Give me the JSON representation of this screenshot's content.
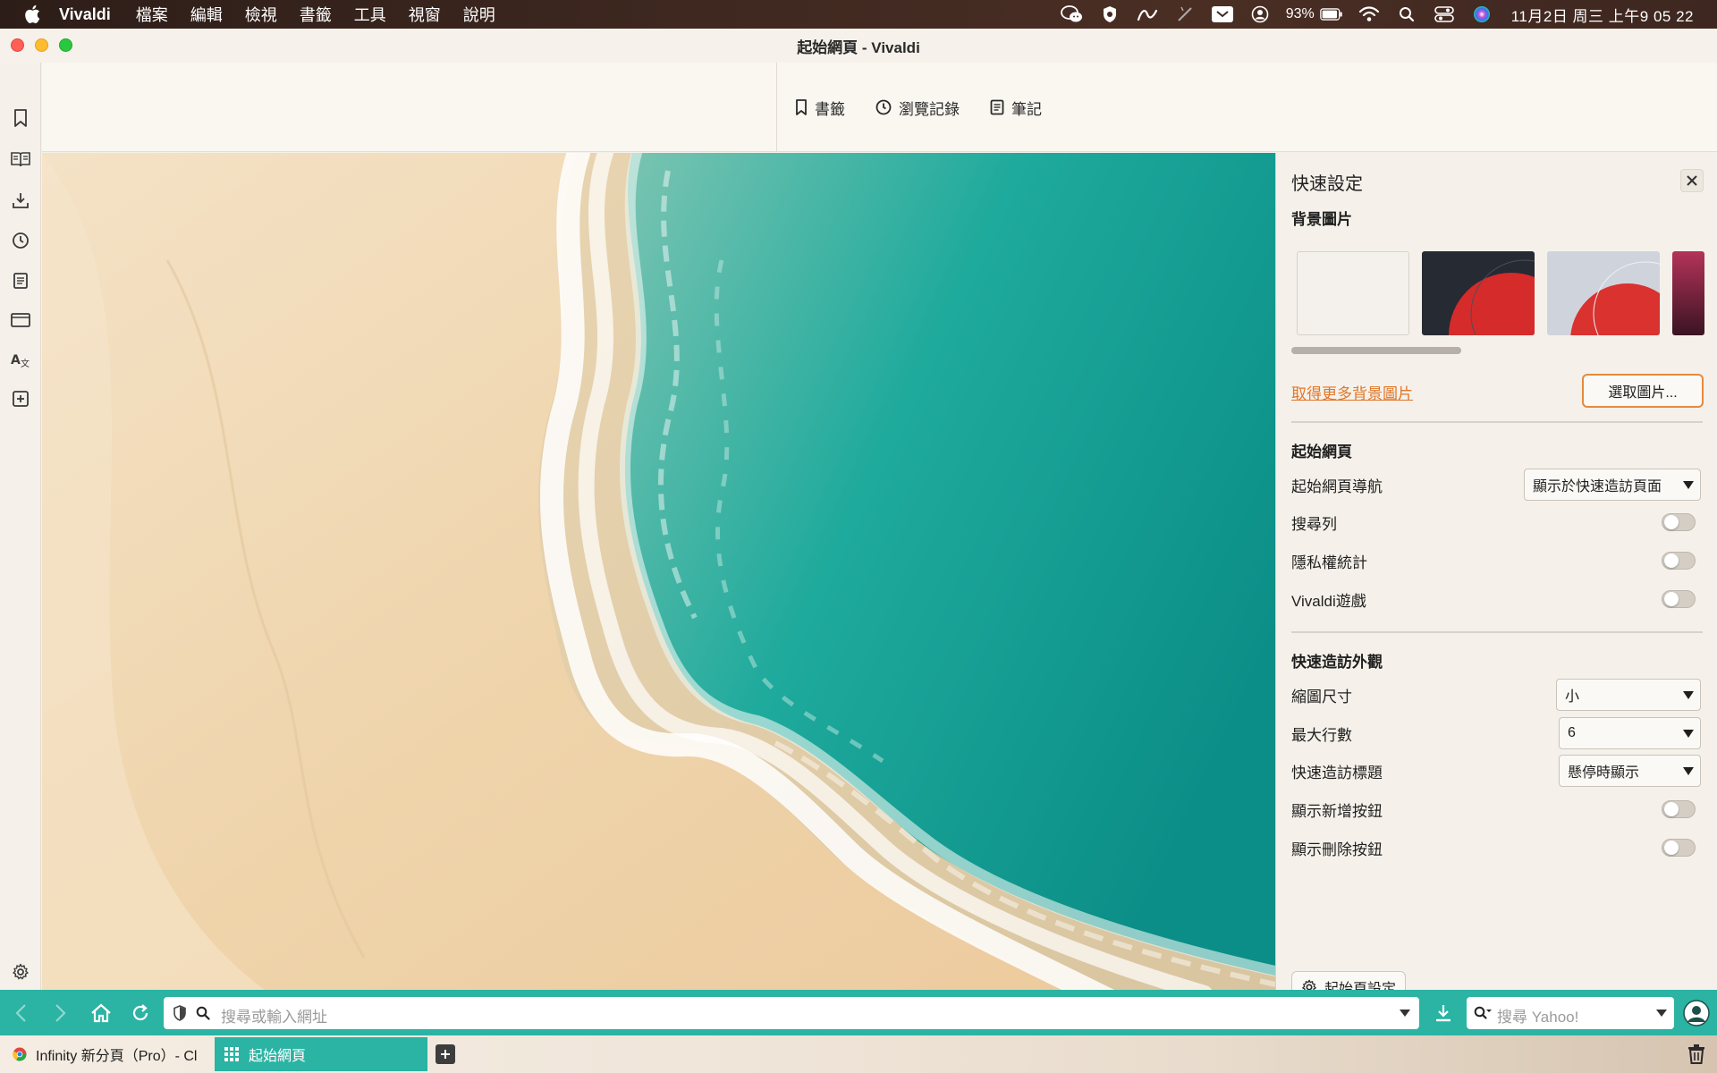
{
  "menubar": {
    "app_name": "Vivaldi",
    "menus": [
      "檔案",
      "編輯",
      "檢視",
      "書籤",
      "工具",
      "視窗",
      "說明"
    ],
    "battery": "93%",
    "clock": "11月2日 周三  上午9 05 22"
  },
  "window": {
    "title": "起始網頁 - Vivaldi"
  },
  "panel_tabs": [
    {
      "label": "書籤",
      "icon": "bookmark-icon"
    },
    {
      "label": "瀏覽記錄",
      "icon": "history-icon"
    },
    {
      "label": "筆記",
      "icon": "notes-icon"
    }
  ],
  "sidebar_icons": [
    "bookmarks-icon",
    "reading-list-icon",
    "downloads-icon",
    "history-icon",
    "notes-icon",
    "window-panel-icon",
    "translate-icon",
    "add-web-panel-icon",
    "settings-icon"
  ],
  "quick_settings": {
    "title": "快速設定",
    "background_section": "背景圖片",
    "more_backgrounds_link": "取得更多背景圖片",
    "pick_image_button": "選取圖片...",
    "start_page_section": "起始網頁",
    "start_nav_label": "起始網頁導航",
    "start_nav_value": "顯示於快速造訪頁面",
    "search_bar_label": "搜尋列",
    "privacy_stats_label": "隱私權統計",
    "vivaldi_game_label": "Vivaldi遊戲",
    "appearance_section": "快速造訪外觀",
    "thumb_size_label": "縮圖尺寸",
    "thumb_size_value": "小",
    "max_columns_label": "最大行數",
    "max_columns_value": "6",
    "speed_dial_title_label": "快速造訪標題",
    "speed_dial_title_value": "懸停時顯示",
    "show_add_label": "顯示新增按鈕",
    "show_delete_label": "顯示刪除按鈕",
    "start_settings_button": "起始頁設定",
    "toggles": {
      "search_bar": false,
      "privacy_stats": false,
      "vivaldi_game": false,
      "show_add": false,
      "show_delete": false
    }
  },
  "addressbar": {
    "url_placeholder": "搜尋或輸入網址",
    "search_placeholder": "搜尋 Yahoo!",
    "accent": "#2bb3a3"
  },
  "tabs": [
    {
      "label": "Infinity 新分頁（Pro）- Cl",
      "active": false
    },
    {
      "label": "起始網頁",
      "active": true
    }
  ]
}
